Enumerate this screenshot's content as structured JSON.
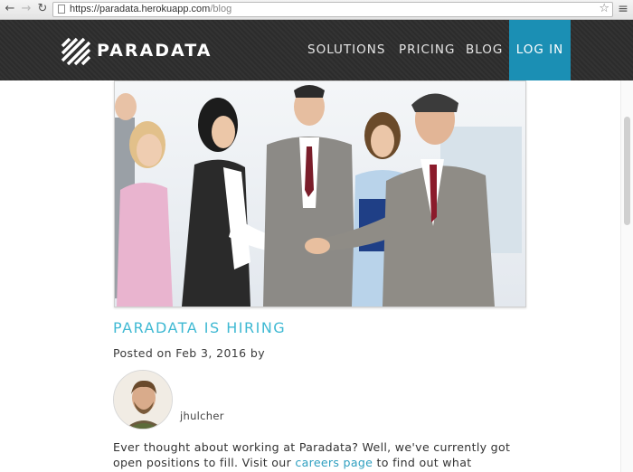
{
  "browser": {
    "url_host": "https://paradata.herokuapp.com",
    "url_path": "/blog",
    "back_icon": "arrow-left-icon",
    "forward_icon": "arrow-right-icon",
    "reload_icon": "reload-icon",
    "bookmark_icon": "star-icon",
    "menu_icon": "hamburger-menu-icon"
  },
  "header": {
    "logo_text": "PARADATA",
    "nav": {
      "solutions": "SOLUTIONS",
      "pricing": "PRICING",
      "blog": "BLOG",
      "login": "LOG IN"
    },
    "colors": {
      "background": "#2f2f2f",
      "login_accent": "#1b8fb4"
    }
  },
  "post": {
    "title": "PARADATA IS HIRING",
    "meta": "Posted on Feb 3, 2016 by",
    "author": "jhulcher",
    "body_part1": "Ever thought about working at Paradata? Well, we've currently got open positions to fill. Visit our ",
    "body_link": "careers page",
    "body_part2": " to find out what",
    "title_color": "#3fb9d3"
  }
}
